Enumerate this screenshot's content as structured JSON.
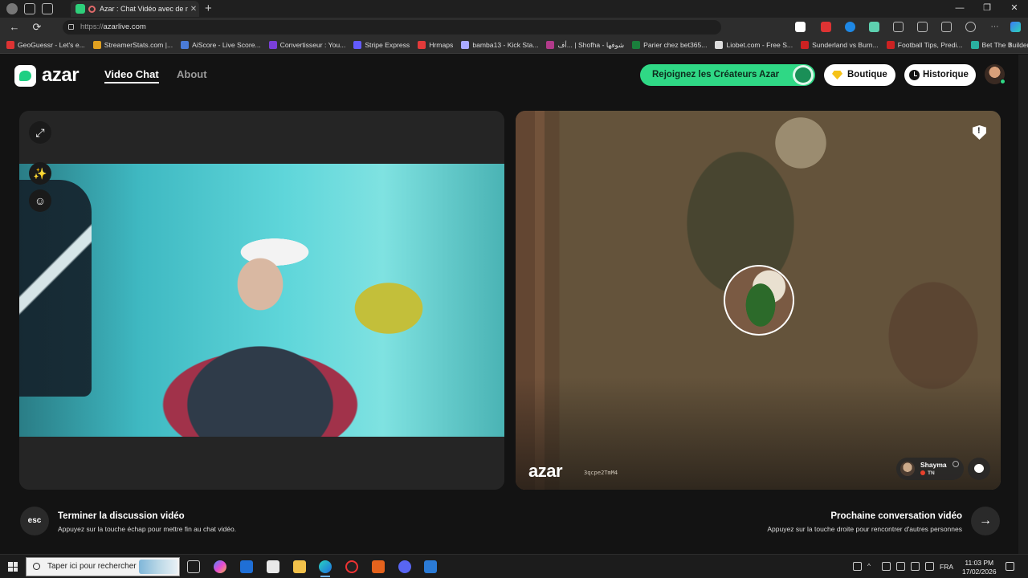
{
  "browser": {
    "tab": {
      "title": "Azar : Chat Vidéo avec de n",
      "close": "✕"
    },
    "new_tab": "+",
    "window_controls": {
      "minimize": "—",
      "maximize": "❐",
      "close": "✕"
    },
    "nav": {
      "back": "←",
      "reload": "⟳",
      "tune": "⚙"
    },
    "url": {
      "scheme": "https://",
      "host": "azarlive.com"
    },
    "bookmarks": [
      {
        "label": "GeoGuessr - Let's e...",
        "color": "#d33"
      },
      {
        "label": "StreamerStats.com |...",
        "color": "#e0a020"
      },
      {
        "label": "AiScore - Live Score...",
        "color": "#4a7bd6"
      },
      {
        "label": "Convertisseur : You...",
        "color": "#7a3fd8"
      },
      {
        "label": "Stripe Express",
        "color": "#635bff"
      },
      {
        "label": "Hrmaps",
        "color": "#e23a3a"
      },
      {
        "label": "bamba13 - Kick Sta...",
        "color": "#aaaaff"
      },
      {
        "label": "أف... | Shofha - شوفها",
        "color": "#b13a8a"
      },
      {
        "label": "Parier chez bet365...",
        "color": "#1a7f3c"
      },
      {
        "label": "Liobet.com - Free S...",
        "color": "#dddddd"
      },
      {
        "label": "Sunderland vs Burn...",
        "color": "#c22"
      },
      {
        "label": "Football Tips, Predi...",
        "color": "#c22"
      },
      {
        "label": "Bet The Builder",
        "color": "#2ab0a0"
      }
    ],
    "bookmarks_more": "›"
  },
  "azar": {
    "logo": "azar",
    "nav": {
      "video_chat": "Video Chat",
      "about": "About"
    },
    "creators_button": "Rejoignez les Créateurs Azar",
    "shop_button": "Boutique",
    "history_button": "Historique"
  },
  "partner": {
    "watermark": "azar",
    "session_code": "3qcpe2TmM4",
    "name": "Shayma",
    "country": "TN"
  },
  "hints": {
    "esc_key": "esc",
    "end_title": "Terminer la discussion vidéo",
    "end_desc": "Appuyez sur la touche échap pour mettre fin au chat vidéo.",
    "next_title": "Prochaine conversation vidéo",
    "next_desc": "Appuyez sur la touche droite pour rencontrer d'autres personnes",
    "next_arrow": "→"
  },
  "taskbar": {
    "search_placeholder": "Taper ici pour rechercher",
    "language": "FRA",
    "time": "11:03 PM",
    "date": "17/02/2026"
  },
  "colors": {
    "accent_green": "#2fd885",
    "page_bg": "#131313",
    "panel_bg": "#252525"
  }
}
